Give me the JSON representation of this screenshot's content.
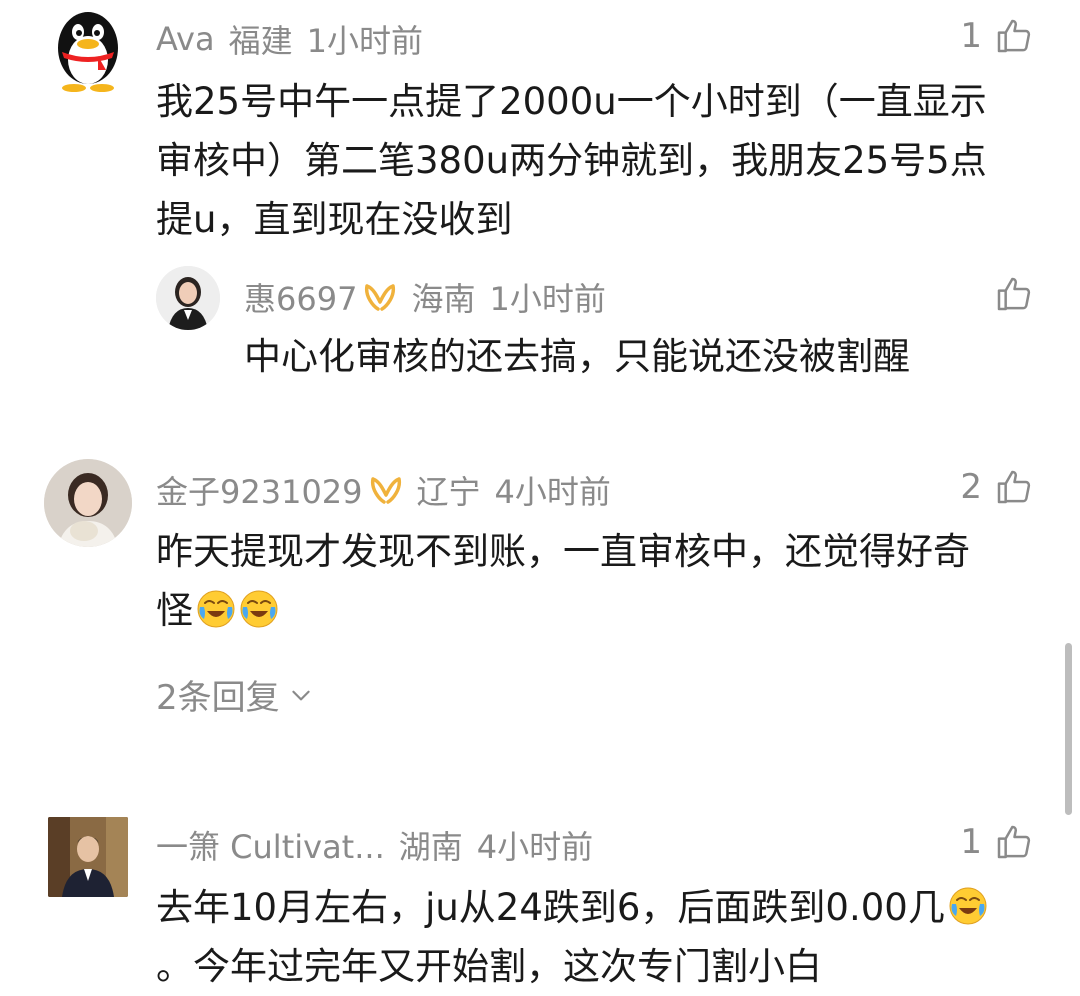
{
  "comments": [
    {
      "user": "Ava",
      "location": "福建",
      "time": "1小时前",
      "likes": "1",
      "text_lines": [
        "我25号中午一点提了2000u一个小时到（一直显示",
        "审核中）第二笔380u两分钟就到，我朋友25号5点",
        "提u，直到现在没收到"
      ],
      "reply": {
        "user": "惠6697",
        "location": "海南",
        "time": "1小时前",
        "text": "中心化审核的还去搞，只能说还没被割醒"
      }
    },
    {
      "user": "金子9231029",
      "location": "辽宁",
      "time": "4小时前",
      "likes": "2",
      "text_lines": [
        "昨天提现才发现不到账，一直审核中，还觉得好奇",
        "怪"
      ],
      "replies_label": "2条回复"
    },
    {
      "user": "一箫 Cultivat...",
      "location": "湖南",
      "time": "4小时前",
      "likes": "1",
      "text_lines": [
        "去年10月左右，ju从24跌到6，后面跌到0.00几",
        "。今年过完年又开始割，这次专门割小白"
      ]
    }
  ],
  "icons": {
    "like": "thumbs-up-outline-icon",
    "badge": "gold-ribbon-badge-icon",
    "emoji": "crying-laughing-emoji",
    "expand": "chevron-down-icon"
  },
  "colors": {
    "meta_gray": "#8a8a8a",
    "text": "#1a1a1a",
    "badge_gold": "#f0b23c"
  }
}
